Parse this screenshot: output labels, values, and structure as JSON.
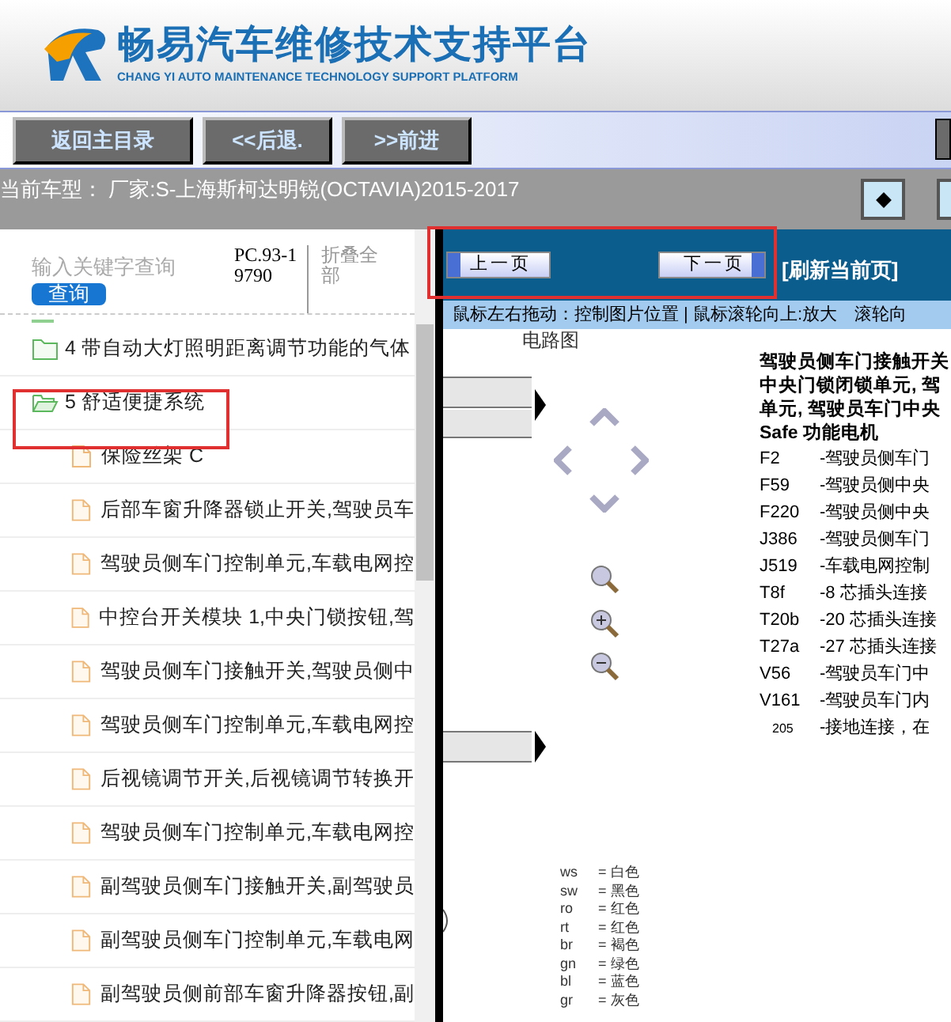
{
  "header": {
    "title": "畅易汽车维修技术支持平台",
    "subtitle": "CHANG YI AUTO MAINTENANCE TECHNOLOGY SUPPORT PLATFORM"
  },
  "toolbar": {
    "buttons": [
      "返回主目录",
      "<<后退.",
      ">>前进"
    ]
  },
  "model_bar": {
    "label": "当前车型：",
    "value": "厂家:S-上海斯柯达明锐(OCTAVIA)2015-2017"
  },
  "search": {
    "placeholder": "输入关键字查询",
    "button": "查询",
    "code": "PC.93-19790",
    "collapse": "折叠全部"
  },
  "tree": [
    {
      "label": "4 带自动大灯照明距离调节功能的气体",
      "kind": "folder",
      "expanded": false
    },
    {
      "label": "5 舒适便捷系统",
      "kind": "folder",
      "expanded": true,
      "children": [
        {
          "label": "保险丝架 C",
          "kind": "file"
        },
        {
          "label": "后部车窗升降器锁止开关,驾驶员车",
          "kind": "file"
        },
        {
          "label": "驾驶员侧车门控制单元,车载电网控",
          "kind": "file"
        },
        {
          "label": "中控台开关模块 1,中央门锁按钮,驾",
          "kind": "file"
        },
        {
          "label": "驾驶员侧车门接触开关,驾驶员侧中",
          "kind": "file"
        },
        {
          "label": "驾驶员侧车门控制单元,车载电网控",
          "kind": "file"
        },
        {
          "label": "后视镜调节开关,后视镜调节转换开",
          "kind": "file"
        },
        {
          "label": "驾驶员侧车门控制单元,车载电网控",
          "kind": "file"
        },
        {
          "label": "副驾驶员侧车门接触开关,副驾驶员",
          "kind": "file"
        },
        {
          "label": "副驾驶员侧车门控制单元,车载电网",
          "kind": "file"
        },
        {
          "label": "副驾驶员侧前部车窗升降器按钮,副",
          "kind": "file"
        }
      ]
    }
  ],
  "viewer": {
    "prev": "上一页",
    "next": "下一页",
    "refresh": "[刷新当前页]",
    "hint": "鼠标左右拖动：控制图片位置 | 鼠标滚轮向上:放大　滚轮向"
  },
  "document": {
    "title": "电路图",
    "heading": [
      "驾驶员侧车门接触开关",
      "中央门锁闭锁单元, 驾",
      "单元, 驾驶员车门中央",
      "Safe 功能电机"
    ],
    "legend": [
      {
        "code": "F2",
        "text": "-驾驶员侧车门"
      },
      {
        "code": "F59",
        "text": "-驾驶员侧中央"
      },
      {
        "code": "F220",
        "text": "-驾驶员侧中央"
      },
      {
        "code": "J386",
        "text": "-驾驶员侧车门"
      },
      {
        "code": "J519",
        "text": "-车载电网控制"
      },
      {
        "code": "T8f",
        "text": "-8 芯插头连接"
      },
      {
        "code": "T20b",
        "text": "-20 芯插头连接"
      },
      {
        "code": "T27a",
        "text": "-27 芯插头连接"
      },
      {
        "code": "V56",
        "text": "-驾驶员车门中"
      },
      {
        "code": "V161",
        "text": "-驾驶员车门内"
      },
      {
        "code": "205",
        "text": "-接地连接，在"
      }
    ],
    "colors": [
      {
        "code": "ws",
        "name": "= 白色"
      },
      {
        "code": "sw",
        "name": "= 黑色"
      },
      {
        "code": "ro",
        "name": "= 红色"
      },
      {
        "code": "rt",
        "name": "= 红色"
      },
      {
        "code": "br",
        "name": "= 褐色"
      },
      {
        "code": "gn",
        "name": "= 绿色"
      },
      {
        "code": "bl",
        "name": "= 蓝色"
      },
      {
        "code": "gr",
        "name": "= 灰色"
      }
    ]
  }
}
